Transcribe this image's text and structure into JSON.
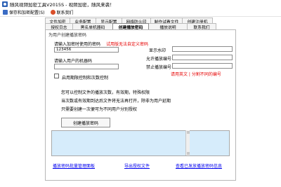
{
  "window": {
    "title": "随风视频加密工具V2015S - 视频加密，随风来袭！"
  },
  "toolbar": {
    "save_label": "保存和加密配置(S)",
    "contact_label": "联系我们"
  },
  "tabs_row1": [
    "文件加密",
    "业务配置",
    "显示配置",
    "网络防火印",
    "制作试看文件",
    "创建注册机"
  ],
  "tabs_row2": [
    "授权日志",
    "黑名单机器码",
    "创建播放密码",
    "播放说明",
    "联系我们"
  ],
  "panel": {
    "group_title": "为用户创建播放密码",
    "password_label": "请输入加密时使用的密码",
    "password_hint": "试用版无法自定义密码",
    "password_value": "123456",
    "machine_code_label": "请输入用户的机器码",
    "machine_code_value": "",
    "watermark_label": "显示水印",
    "watermark_value": "",
    "allow_label": "允许播放编号",
    "allow_value": "",
    "forbid_label": "禁止播放编号",
    "forbid_value": "",
    "separator_hint": "请用英文 | 分割不同的编号",
    "limit_checkbox_label": "启用期限控制和次数控制",
    "info_line1": "您可以控制文件的播放次数，有效期，特殊权限",
    "info_line2": "当次数或有效期到达后文件将无法再打开，除非为用户延期",
    "info_line3": "只需要创建一次便可为不同用户分别授权",
    "generate_button": "创建播放密码",
    "output_value": "",
    "link_batch": "播放密码批量管理面板",
    "link_export": "导出授权文件",
    "link_query": "查看已发放播放密码信息"
  }
}
